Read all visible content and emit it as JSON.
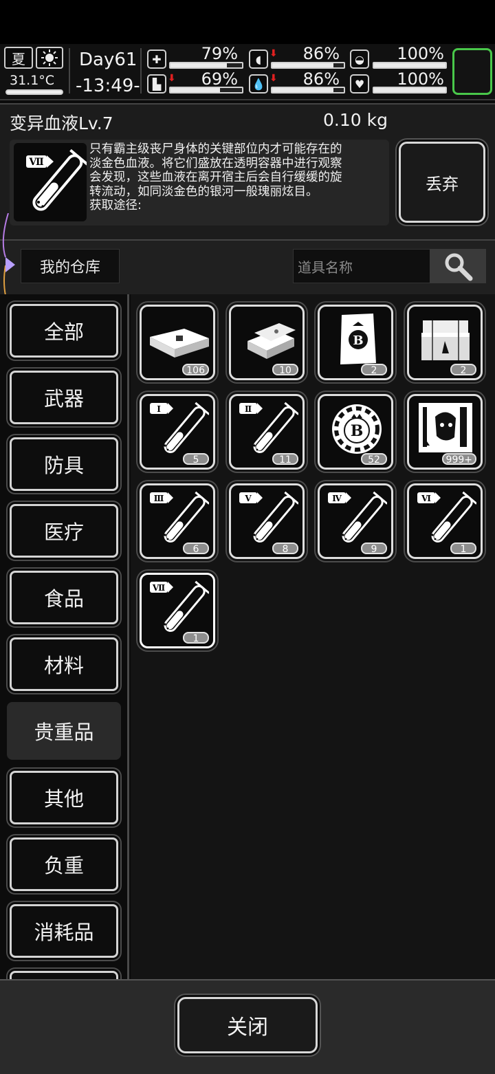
{
  "status": {
    "season": "夏",
    "temperature": "31.1°C",
    "day": "Day61",
    "time": "-13:49-",
    "health_pct": "79%",
    "health_fill": 0.79,
    "stomach_pct": "86%",
    "stomach_fill": 0.86,
    "stomach_down": "⬇",
    "stamina_pct": "100%",
    "stamina_fill": 1.0,
    "leg_pct": "69%",
    "leg_fill": 0.69,
    "leg_down": "⬇",
    "water_pct": "86%",
    "water_fill": 0.86,
    "water_down": "⬇",
    "mood_pct": "100%",
    "mood_fill": 1.0
  },
  "item": {
    "name": "变异血液Lv.7",
    "weight": "0.10  kg",
    "numeral": "Ⅶ",
    "description": "只有霸主级丧尸身体的关键部位内才可能存在的\n淡金色血液。将它们盛放在透明容器中进行观察\n会发现，这些血液在离开宿主后会自行缓缓的旋\n转流动，如同淡金色的银河一般瑰丽炫目。\n获取途径:",
    "discard_label": "丢弃"
  },
  "warehouse": {
    "title": "我的仓库",
    "search_placeholder": "道具名称"
  },
  "categories": [
    "全部",
    "武器",
    "防具",
    "医疗",
    "食品",
    "材料",
    "贵重品",
    "其他",
    "负重",
    "消耗品"
  ],
  "active_category": "贵重品",
  "items": [
    {
      "icon": "cash-bundle-icon",
      "count": "106"
    },
    {
      "icon": "gold-bars-icon",
      "count": "10"
    },
    {
      "icon": "coupon-icon",
      "count": "2"
    },
    {
      "icon": "treasure-chest-icon",
      "count": "2"
    },
    {
      "icon": "blood-vial-1-icon",
      "numeral": "Ⅰ",
      "count": "5"
    },
    {
      "icon": "blood-vial-2-icon",
      "numeral": "Ⅱ",
      "count": "11"
    },
    {
      "icon": "casino-chip-icon",
      "count": "52"
    },
    {
      "icon": "zombie-card-icon",
      "count": "999+"
    },
    {
      "icon": "blood-vial-3-icon",
      "numeral": "Ⅲ",
      "count": "6"
    },
    {
      "icon": "blood-vial-5-icon",
      "numeral": "Ⅴ",
      "count": "8"
    },
    {
      "icon": "blood-vial-4-icon",
      "numeral": "Ⅳ",
      "count": "9"
    },
    {
      "icon": "blood-vial-6-icon",
      "numeral": "Ⅵ",
      "count": "1"
    },
    {
      "icon": "blood-vial-7-icon",
      "numeral": "Ⅶ",
      "count": "1"
    }
  ],
  "close_label": "关闭"
}
